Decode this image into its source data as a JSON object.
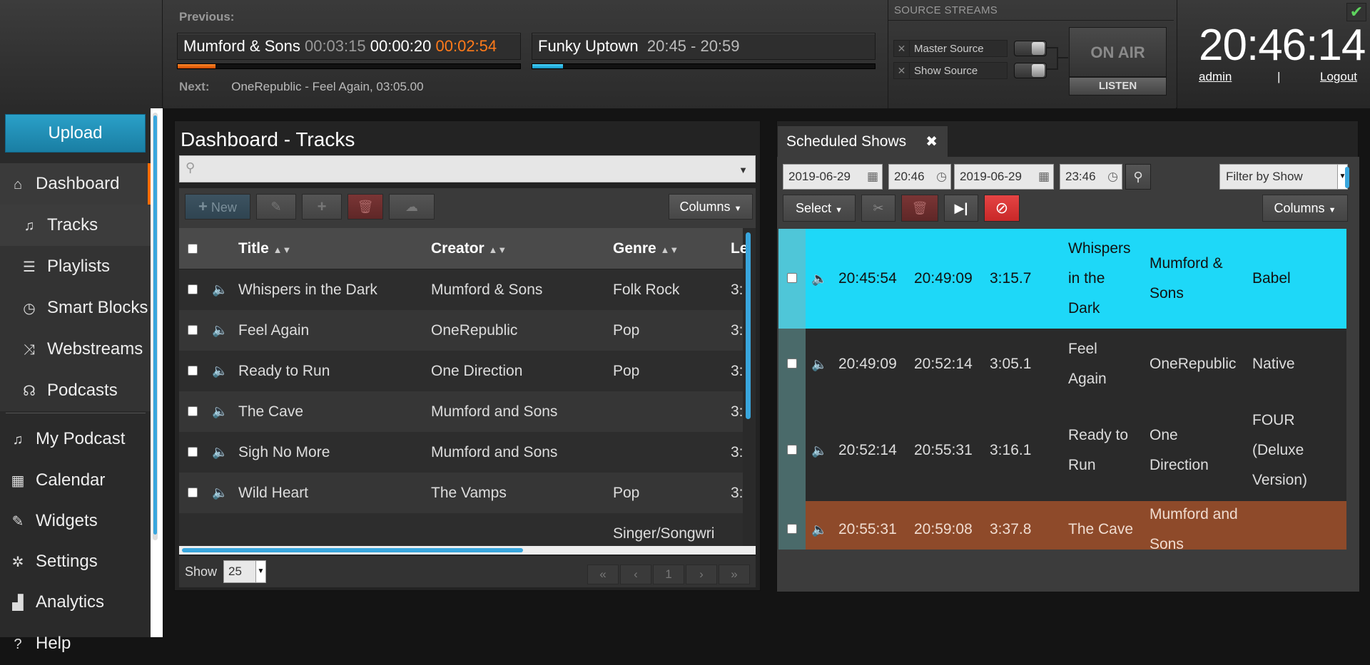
{
  "player": {
    "previous_label": "Previous:",
    "current_artist": "Mumford & Sons",
    "current_duration": "00:03:15",
    "current_elapsed": "00:00:20",
    "current_remaining": "00:02:54",
    "track_progress": 0.11,
    "show_name": "Funky Uptown",
    "show_time": "20:45 - 20:59",
    "show_progress": 0.09,
    "next_label": "Next:",
    "next_track": "OneRepublic - Feel Again, 03:05.00"
  },
  "sources": {
    "title": "SOURCE STREAMS",
    "master": "Master Source",
    "show": "Show Source",
    "close_glyph": "✕",
    "on_air": "ON AIR",
    "listen": "LISTEN"
  },
  "clock": {
    "time": "20:46:14",
    "admin": "admin",
    "separator": "|",
    "logout": "Logout",
    "status_icon": "✔"
  },
  "sidebar": {
    "upload": "Upload",
    "items": [
      {
        "label": "Dashboard",
        "icon": "⌂"
      },
      {
        "label": "Tracks",
        "icon": "♫"
      },
      {
        "label": "Playlists",
        "icon": "☰"
      },
      {
        "label": "Smart Blocks",
        "icon": "◷"
      },
      {
        "label": "Webstreams",
        "icon": "⤨"
      },
      {
        "label": "Podcasts",
        "icon": "☊"
      },
      {
        "label": "My Podcast",
        "icon": "♫"
      },
      {
        "label": "Calendar",
        "icon": "▦"
      },
      {
        "label": "Widgets",
        "icon": "✎"
      },
      {
        "label": "Settings",
        "icon": "✲"
      },
      {
        "label": "Analytics",
        "icon": "▟"
      },
      {
        "label": "Help",
        "icon": "?"
      }
    ]
  },
  "tracks": {
    "title": "Dashboard - Tracks",
    "toolbar": {
      "new": "New",
      "columns": "Columns"
    },
    "headers": {
      "title": "Title",
      "creator": "Creator",
      "genre": "Genre",
      "length": "Le"
    },
    "rows": [
      {
        "title": "Whispers in the Dark",
        "creator": "Mumford & Sons",
        "genre": "Folk Rock",
        "length": "3:"
      },
      {
        "title": "Feel Again",
        "creator": "OneRepublic",
        "genre": "Pop",
        "length": "3:"
      },
      {
        "title": "Ready to Run",
        "creator": "One Direction",
        "genre": "Pop",
        "length": "3:"
      },
      {
        "title": "The Cave",
        "creator": "Mumford and Sons",
        "genre": "",
        "length": "3:"
      },
      {
        "title": "Sigh No More",
        "creator": "Mumford and Sons",
        "genre": "",
        "length": "3:"
      },
      {
        "title": "Wild Heart",
        "creator": "The Vamps",
        "genre": "Pop",
        "length": "3:"
      },
      {
        "title": "",
        "creator": "",
        "genre": "Singer/Songwri",
        "length": ""
      }
    ],
    "footer": {
      "show_label": "Show",
      "page_size": "25",
      "first": "«",
      "prev": "‹",
      "page": "1",
      "next": "›",
      "last": "»"
    }
  },
  "scheduled": {
    "tab": "Scheduled Shows",
    "tab_close": "✖",
    "start_date": "2019-06-29",
    "start_time": "20:46",
    "end_date": "2019-06-29",
    "end_time": "23:46",
    "filter": "Filter by Show",
    "select": "Select",
    "columns": "Columns",
    "rows": [
      {
        "start": "20:45:54",
        "end": "20:49:09",
        "duration": "3:15.7",
        "title": [
          "Whispers",
          "in the",
          "Dark"
        ],
        "creator": [
          "Mumford &",
          "Sons"
        ],
        "album": [
          "Babel"
        ],
        "state": "playing"
      },
      {
        "start": "20:49:09",
        "end": "20:52:14",
        "duration": "3:05.1",
        "title": [
          "Feel",
          "Again"
        ],
        "creator": [
          "OneRepublic"
        ],
        "album": [
          "Native"
        ],
        "state": "future"
      },
      {
        "start": "20:52:14",
        "end": "20:55:31",
        "duration": "3:16.1",
        "title": [
          "Ready to",
          "Run"
        ],
        "creator": [
          "One",
          "Direction"
        ],
        "album": [
          "FOUR",
          "(Deluxe",
          "Version)"
        ],
        "state": "future-alt"
      },
      {
        "start": "20:55:31",
        "end": "20:59:08",
        "duration": "3:37.8",
        "title": [
          "The Cave"
        ],
        "creator": [
          "Mumford and",
          "Sons"
        ],
        "album": [
          ""
        ],
        "state": "overflow"
      }
    ]
  }
}
